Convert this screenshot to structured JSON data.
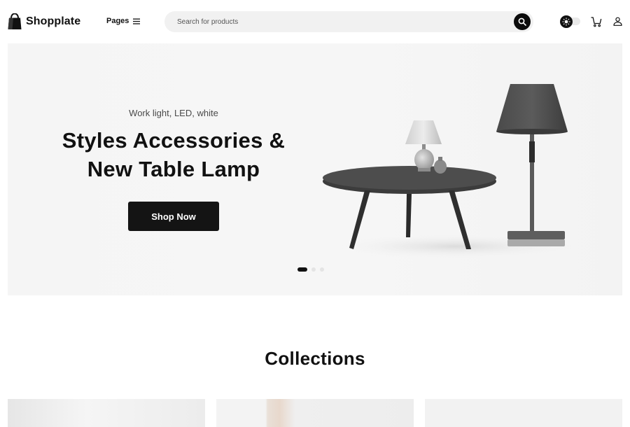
{
  "brand": {
    "name": "Shopplate",
    "icon": "shopping-bag-icon"
  },
  "nav": {
    "pages_label": "Pages",
    "pages_icon": "hamburger-menu-icon"
  },
  "search": {
    "placeholder": "Search for products",
    "value": "",
    "button_icon": "search-icon"
  },
  "header_actions": {
    "theme_icon": "sun-icon",
    "cart_icon": "cart-icon",
    "user_icon": "user-icon"
  },
  "hero": {
    "eyebrow": "Work light, LED, white",
    "title_line1": "Styles Accessories &",
    "title_line2": "New Table Lamp",
    "cta_label": "Shop Now",
    "slides": [
      {
        "active": true
      },
      {
        "active": false
      },
      {
        "active": false
      }
    ]
  },
  "collections": {
    "title": "Collections"
  },
  "colors": {
    "primary": "#111111",
    "background": "#ffffff",
    "hero_background": "#f5f5f5",
    "search_background": "#f1f1f1"
  }
}
